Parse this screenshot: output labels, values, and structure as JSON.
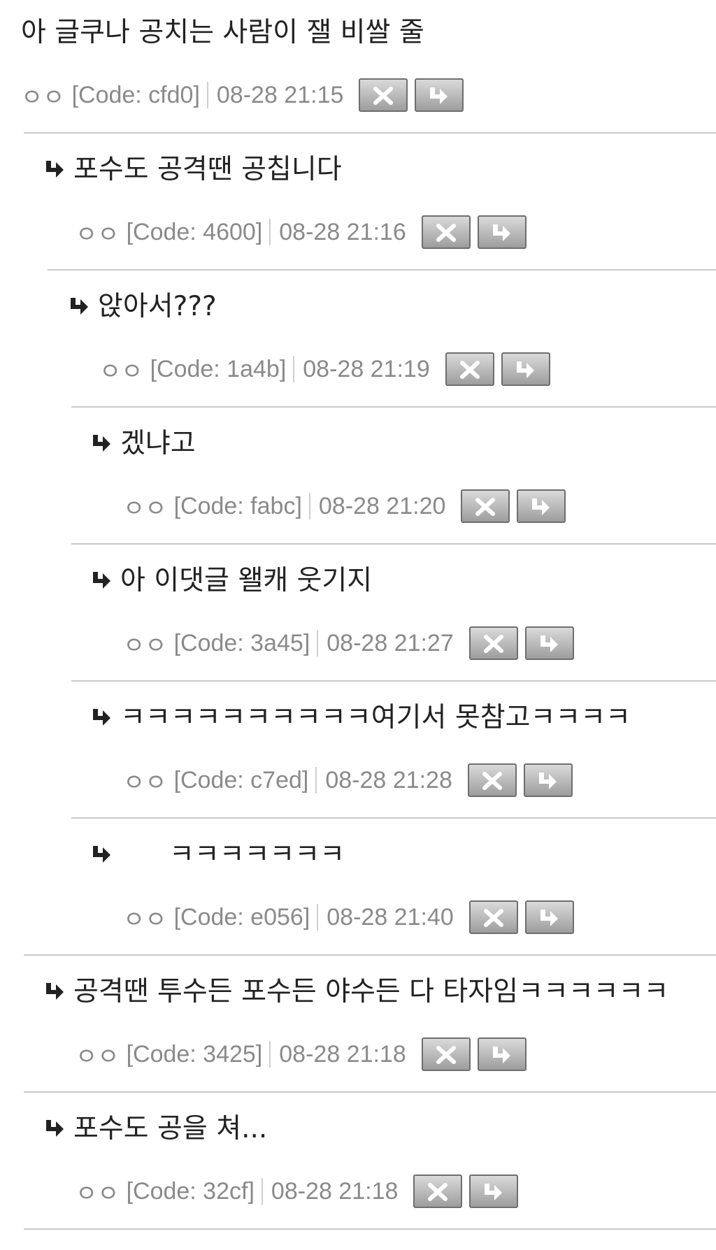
{
  "comments": [
    {
      "text": "아 글쿠나 공치는 사람이 잴 비쌀 줄",
      "nick": "ㅇㅇ",
      "code": "[Code: cfd0]",
      "date": "08-28 21:15",
      "depth": 0
    },
    {
      "text": "포수도 공격땐 공칩니다",
      "nick": "ㅇㅇ",
      "code": "[Code: 4600]",
      "date": "08-28 21:16",
      "depth": 1
    },
    {
      "text": "앉아서???",
      "nick": "ㅇㅇ",
      "code": "[Code: 1a4b]",
      "date": "08-28 21:19",
      "depth": 2
    },
    {
      "text": "겠냐고",
      "nick": "ㅇㅇ",
      "code": "[Code: fabc]",
      "date": "08-28 21:20",
      "depth": 3
    },
    {
      "text": "아 이댓글 왤캐 웃기지",
      "nick": "ㅇㅇ",
      "code": "[Code: 3a45]",
      "date": "08-28 21:27",
      "depth": 3
    },
    {
      "text": "ㅋㅋㅋㅋㅋㅋㅋㅋㅋㅋ여기서 못참고ㅋㅋㅋㅋ",
      "nick": "ㅇㅇ",
      "code": "[Code: c7ed]",
      "date": "08-28 21:28",
      "depth": 3
    },
    {
      "text": "ㅋㅋㅋㅋㅋㅋㅋ",
      "nick": "ㅇㅇ",
      "code": "[Code: e056]",
      "date": "08-28 21:40",
      "depth": 3
    },
    {
      "text": "공격땐 투수든 포수든 야수든 다 타자임ㅋㅋㅋㅋㅋㅋ",
      "nick": "ㅇㅇ",
      "code": "[Code: 3425]",
      "date": "08-28 21:18",
      "depth": 1
    },
    {
      "text": "포수도 공을 쳐...",
      "nick": "ㅇㅇ",
      "code": "[Code: 32cf]",
      "date": "08-28 21:18",
      "depth": 1
    }
  ],
  "icons": {
    "delete": "close-icon",
    "reply": "reply-arrow-icon"
  },
  "colors": {
    "text": "#222222",
    "meta": "#8a8a8a",
    "divider": "#c9c9c9",
    "button_top": "#dadada",
    "button_bottom": "#9d9d9d"
  }
}
